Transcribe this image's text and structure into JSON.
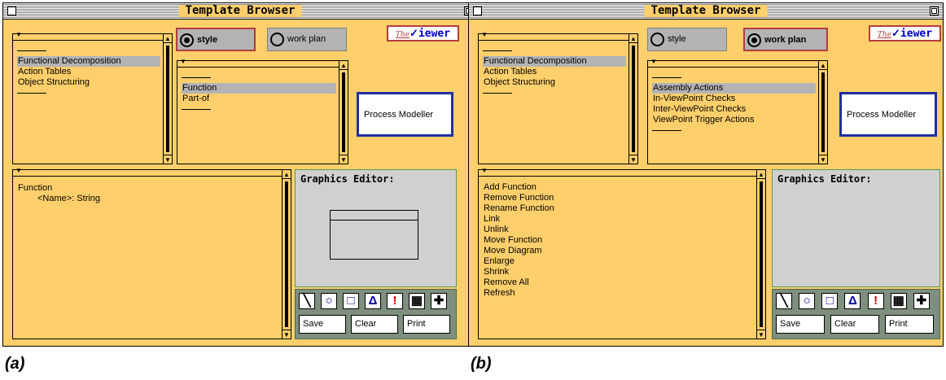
{
  "window_a": {
    "title": "Template Browser",
    "logo": {
      "the": "The",
      "word": "iewer"
    },
    "top_list": {
      "items": [
        "Functional Decomposition",
        "Action Tables",
        "Object Structuring"
      ],
      "selected_index": 0
    },
    "radio_style": {
      "label": "style",
      "selected": true
    },
    "radio_workplan": {
      "label": "work plan",
      "selected": false
    },
    "mid_list": {
      "items": [
        "Function",
        "Part-of"
      ],
      "selected_index": 0
    },
    "modeller_label": "Process Modeller",
    "bottom_list": {
      "items": [
        "Function",
        "<Name>: String"
      ]
    },
    "graphics": {
      "title": "Graphics Editor:",
      "show_shape": true
    },
    "buttons": {
      "save": "Save",
      "clear": "Clear",
      "print": "Print"
    }
  },
  "window_b": {
    "title": "Template Browser",
    "logo": {
      "the": "The",
      "word": "iewer"
    },
    "top_list": {
      "items": [
        "Functional Decomposition",
        "Action Tables",
        "Object Structuring"
      ],
      "selected_index": 0
    },
    "radio_style": {
      "label": "style",
      "selected": false
    },
    "radio_workplan": {
      "label": "work plan",
      "selected": true
    },
    "mid_list": {
      "items": [
        "Assembly Actions",
        "In-ViewPoint Checks",
        "Inter-ViewPoint Checks",
        "ViewPoint Trigger Actions"
      ],
      "selected_index": 0
    },
    "modeller_label": "Process Modeller",
    "bottom_list": {
      "items": [
        "Add Function",
        "Remove Function",
        "Rename Function",
        "Link",
        "Unlink",
        "Move Function",
        "Move Diagram",
        "Enlarge",
        "Shrink",
        "Remove All",
        "Refresh"
      ]
    },
    "graphics": {
      "title": "Graphics Editor:",
      "show_shape": false
    },
    "buttons": {
      "save": "Save",
      "clear": "Clear",
      "print": "Print"
    }
  },
  "tools": [
    {
      "name": "line-tool-icon",
      "glyph": "╲"
    },
    {
      "name": "circle-tool-icon",
      "glyph": "○"
    },
    {
      "name": "square-tool-icon",
      "glyph": "□"
    },
    {
      "name": "triangle-tool-icon",
      "glyph": "Δ"
    },
    {
      "name": "exclamation-tool-icon",
      "glyph": "!"
    },
    {
      "name": "grid-tool-icon",
      "glyph": "▦"
    },
    {
      "name": "move-tool-icon",
      "glyph": "✚"
    }
  ],
  "captions": {
    "a": "(a)",
    "b": "(b)"
  }
}
